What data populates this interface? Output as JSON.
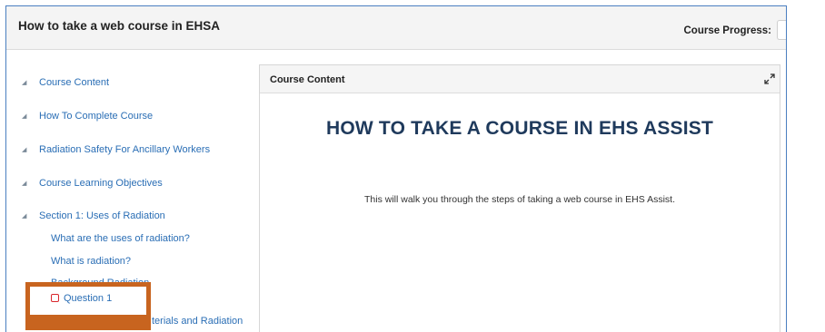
{
  "header": {
    "title": "How to take a web course in EHSA",
    "progress_label": "Course Progress:"
  },
  "sidebar": {
    "items": [
      {
        "label": "Course Content"
      },
      {
        "label": "How To Complete Course"
      },
      {
        "label": "Radiation Safety For Ancillary Workers"
      },
      {
        "label": "Course Learning Objectives"
      },
      {
        "label": "Section 1: Uses of Radiation"
      }
    ],
    "subitems": [
      {
        "label": "What are the uses of radiation?"
      },
      {
        "label": "What is radiation?"
      },
      {
        "label": "Background Radiation"
      }
    ],
    "question": {
      "label": "Question 1",
      "icon": "quiz-checkbox-icon",
      "icon_color": "#d9262c"
    },
    "partial_item": {
      "label": "terials and Radiation"
    },
    "highlight_color": "#c8641f"
  },
  "panel": {
    "title": "Course Content",
    "heading": "HOW TO TAKE A COURSE IN EHS ASSIST",
    "intro": "This will walk you through the steps of taking a web course in EHS Assist."
  }
}
